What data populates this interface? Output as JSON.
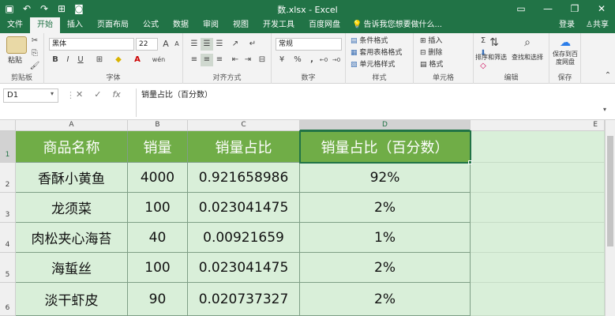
{
  "window": {
    "title": "数.xlsx - Excel",
    "minimize": "—",
    "restore": "❐",
    "close": "✕"
  },
  "quick_access": [
    "save-icon",
    "undo-icon",
    "redo-icon",
    "screenshot-icon",
    "camera-icon"
  ],
  "tabs": [
    "文件",
    "开始",
    "插入",
    "页面布局",
    "公式",
    "数据",
    "审阅",
    "视图",
    "开发工具",
    "百度网盘"
  ],
  "active_tab": "开始",
  "tell_me": "告诉我您想要做什么...",
  "account": {
    "login": "登录",
    "share": "共享"
  },
  "ribbon": {
    "clipboard": {
      "label": "剪贴板",
      "paste": "粘贴"
    },
    "font": {
      "label": "字体",
      "name": "黑体",
      "size": "22",
      "bold": "B",
      "italic": "I",
      "underline": "U",
      "grow": "A",
      "shrink": "A",
      "wen": "wén"
    },
    "align": {
      "label": "对齐方式"
    },
    "number": {
      "label": "数字",
      "format": "常规",
      "percent": "%",
      "comma": ","
    },
    "styles": {
      "label": "样式",
      "cond": "条件格式",
      "table": "套用表格格式",
      "cell": "单元格样式"
    },
    "cells": {
      "label": "单元格",
      "insert": "插入",
      "delete": "删除",
      "format": "格式"
    },
    "editing": {
      "label": "编辑",
      "sort": "排序和筛选",
      "find": "查找和选择"
    },
    "save": {
      "label": "保存",
      "baidu": "保存到百度网盘"
    }
  },
  "formula_bar": {
    "name_box": "D1",
    "fx": "fx",
    "formula": "销量占比（百分数）"
  },
  "columns": [
    "A",
    "B",
    "C",
    "D",
    "E"
  ],
  "rows": [
    "1",
    "2",
    "3",
    "4",
    "5",
    "6"
  ],
  "selected": {
    "column": "D",
    "row": "1"
  },
  "table": {
    "headers": [
      "商品名称",
      "销量",
      "销量占比",
      "销量占比（百分数）"
    ],
    "rows": [
      [
        "香酥小黄鱼",
        "4000",
        "0.921658986",
        "92%"
      ],
      [
        "龙须菜",
        "100",
        "0.023041475",
        "2%"
      ],
      [
        "肉松夹心海苔",
        "40",
        "0.00921659",
        "1%"
      ],
      [
        "海蜇丝",
        "100",
        "0.023041475",
        "2%"
      ],
      [
        "淡干虾皮",
        "90",
        "0.020737327",
        "2%"
      ]
    ]
  },
  "colors": {
    "accent": "#217346",
    "header_fill": "#70ad47",
    "data_fill": "#d9efd9"
  }
}
